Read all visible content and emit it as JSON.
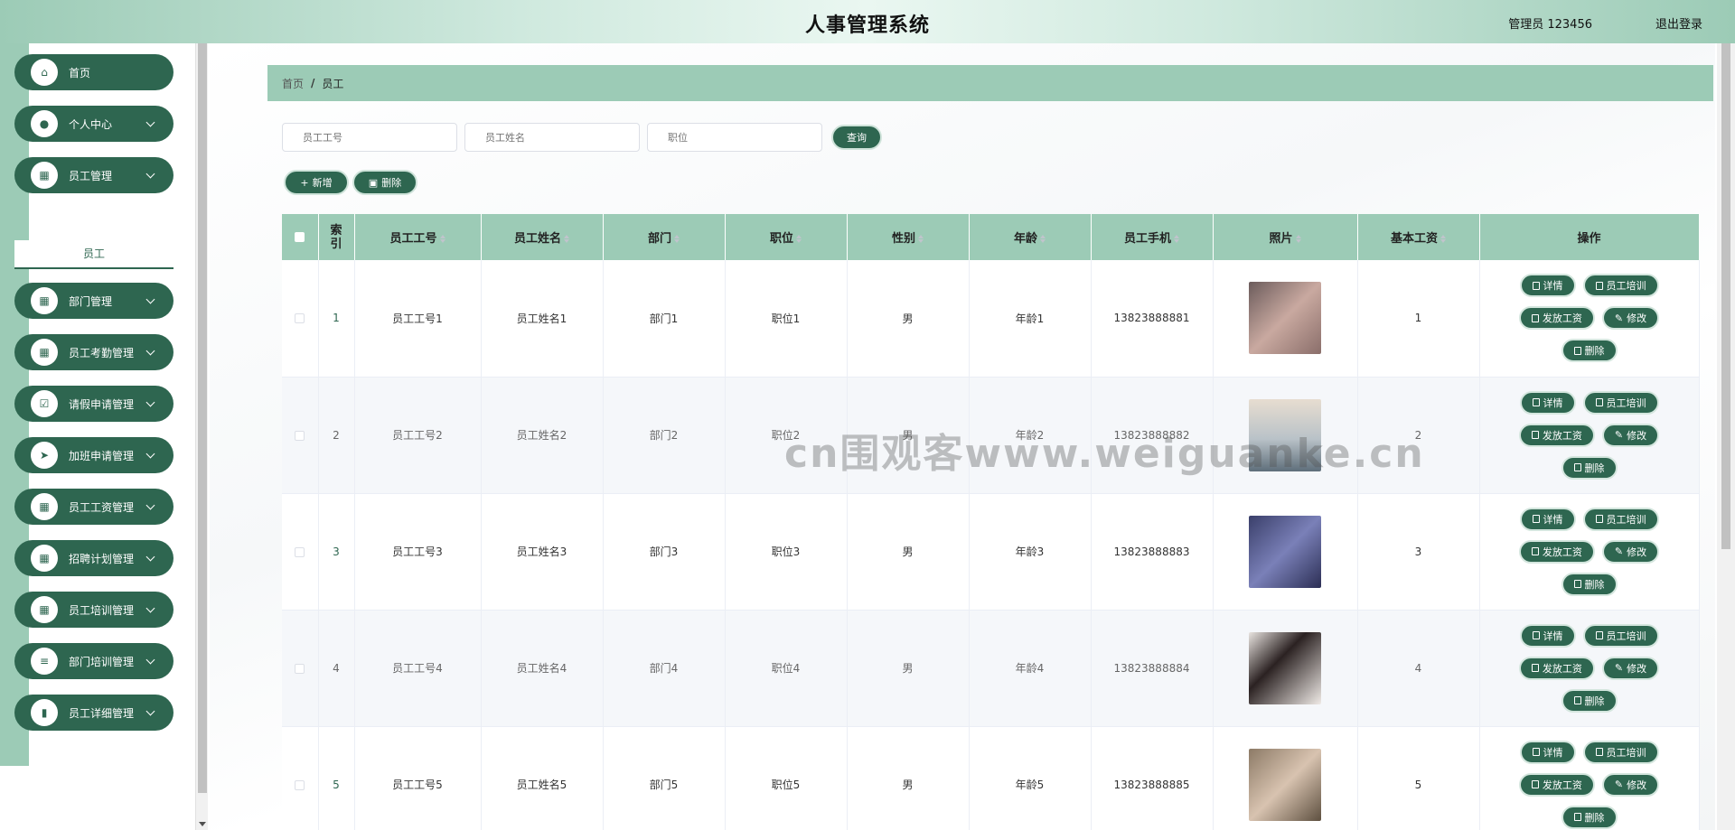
{
  "header": {
    "title": "人事管理系统",
    "user": "管理员 123456",
    "logout": "退出登录"
  },
  "sidebar": {
    "items": [
      {
        "label": "首页",
        "icon": "home-icon",
        "glyph": "⌂",
        "arrow": false
      },
      {
        "label": "个人中心",
        "icon": "user-icon",
        "glyph": "●",
        "arrow": true
      },
      {
        "label": "员工管理",
        "icon": "grid-icon",
        "glyph": "▦",
        "arrow": true
      },
      {
        "label": "部门管理",
        "icon": "grid-icon",
        "glyph": "▦",
        "arrow": true
      },
      {
        "label": "员工考勤管理",
        "icon": "grid-icon",
        "glyph": "▦",
        "arrow": true
      },
      {
        "label": "请假申请管理",
        "icon": "check-icon",
        "glyph": "☑",
        "arrow": true
      },
      {
        "label": "加班申请管理",
        "icon": "send-icon",
        "glyph": "➤",
        "arrow": true
      },
      {
        "label": "员工工资管理",
        "icon": "grid-icon",
        "glyph": "▦",
        "arrow": true
      },
      {
        "label": "招聘计划管理",
        "icon": "grid-icon",
        "glyph": "▦",
        "arrow": true
      },
      {
        "label": "员工培训管理",
        "icon": "grid-icon",
        "glyph": "▦",
        "arrow": true
      },
      {
        "label": "部门培训管理",
        "icon": "list-icon",
        "glyph": "≡",
        "arrow": true
      },
      {
        "label": "员工详细管理",
        "icon": "chart-icon",
        "glyph": "▮",
        "arrow": true
      }
    ],
    "submenu": "员工"
  },
  "breadcrumb": {
    "home": "首页",
    "sep": "/",
    "current": "员工"
  },
  "search": {
    "emp_no_placeholder": "员工工号",
    "emp_name_placeholder": "员工姓名",
    "position_placeholder": "职位",
    "query": "查询"
  },
  "toolbar": {
    "add": "新增",
    "delete": "删除"
  },
  "table": {
    "headers": [
      "索引",
      "员工工号",
      "员工姓名",
      "部门",
      "职位",
      "性别",
      "年龄",
      "员工手机",
      "照片",
      "基本工资",
      "操作"
    ],
    "rows": [
      {
        "idx": "1",
        "no": "员工工号1",
        "name": "员工姓名1",
        "dept": "部门1",
        "pos": "职位1",
        "sex": "男",
        "age": "年龄1",
        "phone": "13823888881",
        "salary": "1"
      },
      {
        "idx": "2",
        "no": "员工工号2",
        "name": "员工姓名2",
        "dept": "部门2",
        "pos": "职位2",
        "sex": "男",
        "age": "年龄2",
        "phone": "13823888882",
        "salary": "2"
      },
      {
        "idx": "3",
        "no": "员工工号3",
        "name": "员工姓名3",
        "dept": "部门3",
        "pos": "职位3",
        "sex": "男",
        "age": "年龄3",
        "phone": "13823888883",
        "salary": "3"
      },
      {
        "idx": "4",
        "no": "员工工号4",
        "name": "员工姓名4",
        "dept": "部门4",
        "pos": "职位4",
        "sex": "男",
        "age": "年龄4",
        "phone": "13823888884",
        "salary": "4"
      },
      {
        "idx": "5",
        "no": "员工工号5",
        "name": "员工姓名5",
        "dept": "部门5",
        "pos": "职位5",
        "sex": "男",
        "age": "年龄5",
        "phone": "13823888885",
        "salary": "5"
      }
    ],
    "ops": {
      "detail": "详情",
      "training": "员工培训",
      "pay": "发放工资",
      "edit": "修改",
      "delete": "删除"
    }
  },
  "watermark": "cn围观客www.weiguanke.cn",
  "colors": {
    "primary": "#2e6650",
    "accent": "#9ccbb6"
  }
}
